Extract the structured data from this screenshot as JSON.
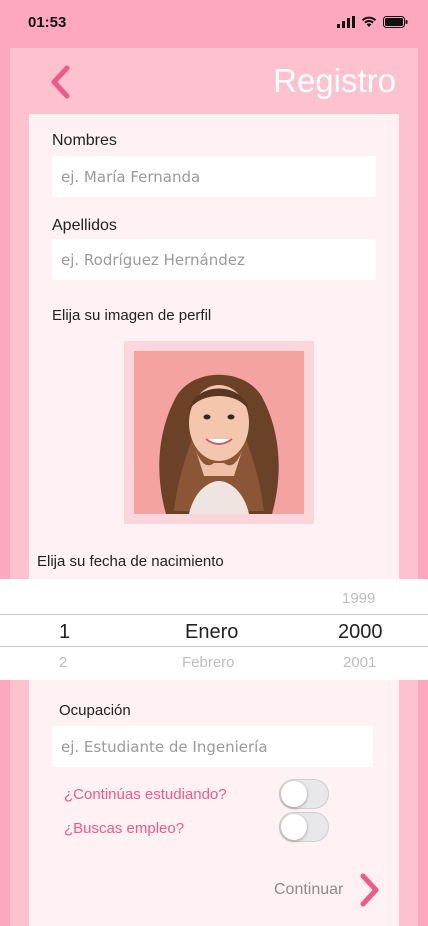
{
  "status": {
    "time": "01:53"
  },
  "header": {
    "title": "Registro"
  },
  "form": {
    "nombres": {
      "label": "Nombres",
      "placeholder": "ej. María Fernanda"
    },
    "apellidos": {
      "label": "Apellidos",
      "placeholder": "ej. Rodríguez Hernández"
    },
    "image": {
      "label": "Elija su imagen de perfil"
    },
    "birthdate": {
      "label": "Elija su fecha de nacimiento",
      "day": {
        "above": "",
        "selected": "1",
        "below": "2"
      },
      "month": {
        "above": "",
        "selected": "Enero",
        "below": "Febrero"
      },
      "year": {
        "above": "1999",
        "selected": "2000",
        "below": "2001"
      }
    },
    "ocupacion": {
      "label": "Ocupación",
      "placeholder": "ej. Estudiante de Ingeniería"
    },
    "studying": {
      "label": "¿Continúas estudiando?",
      "on": false
    },
    "employment": {
      "label": "¿Buscas empleo?",
      "on": false
    }
  },
  "footer": {
    "continue_label": "Continuar"
  },
  "colors": {
    "accent": "#ef5a8a",
    "background": "#fda8be",
    "card": "#fdc1cf"
  }
}
